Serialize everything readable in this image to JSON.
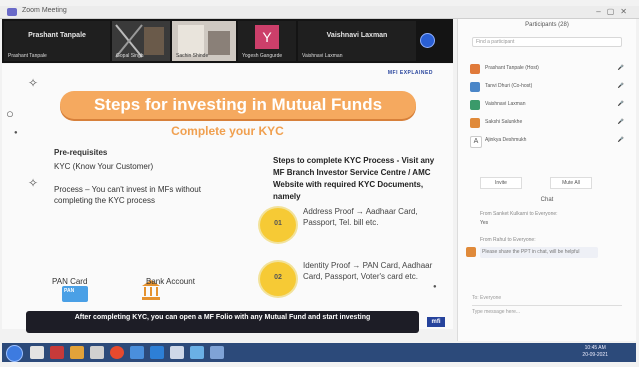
{
  "window": {
    "app_title": "Zoom Meeting"
  },
  "participants_strip": [
    {
      "name": "Prashant Tanpale",
      "caption": "Prashant Tanpale"
    },
    {
      "name": "",
      "caption": "Gopal Singh"
    },
    {
      "name": "",
      "caption": "Sachin Shinde"
    },
    {
      "name": "",
      "caption": "Yogesh Gangurde"
    },
    {
      "name": "Vaishnavi Laxman",
      "caption": "Vaishnavi Laxman"
    }
  ],
  "avatar_letter": "Y",
  "slide": {
    "brand": "MFI EXPLAINED",
    "banner": "Steps for investing in Mutual Funds",
    "subheading": "Complete your KYC",
    "prereq_title": "Pre-requisites",
    "prereq_kyc": "KYC (Know Your Customer)",
    "process_text": "Process – You can't invest in MFs without completing the KYC process",
    "pan_label": "PAN Card",
    "pan_card_text": "PAN",
    "bank_label": "Bank Account",
    "steps_heading": "Steps to complete KYC Process - Visit any MF Branch Investor Service Centre / AMC Website with required KYC Documents, namely",
    "bullets": [
      {
        "num": "01",
        "text": "Address Proof → Aadhaar Card, Passport, Tel. bill etc."
      },
      {
        "num": "02",
        "text": "Identity Proof → PAN Card, Aadhaar Card, Passport, Voter's card etc."
      }
    ],
    "footer": "After completing KYC, you can open a MF Folio with any Mutual Fund and start investing",
    "footer_logo": "mfi"
  },
  "panel": {
    "title": "Participants (28)",
    "search_placeholder": "Find a participant",
    "participants": [
      {
        "name": "Prashant Tanpale (Host)",
        "status": "mic",
        "color": "#e07a3a"
      },
      {
        "name": "Tanvi Dhuri (Co-host)",
        "status": "mic",
        "color": "#4a86c8"
      },
      {
        "name": "Vaishnavi Laxman",
        "status": "mic",
        "color": "#3a9a6a"
      },
      {
        "name": "Sakshi Salunkhe",
        "status": "mic",
        "color": "#e08a3a"
      },
      {
        "name": "Ajinkya Deshmukh",
        "status": "mic",
        "color": "#ffffff"
      }
    ],
    "invite_label": "Invite",
    "mute_label": "Mute All",
    "chat_title": "Chat",
    "chat_messages": [
      "From Sanket Kulkarni to Everyone:",
      "Yes",
      "From Rahul to Everyone:",
      "Please share the PPT in chat, will be helpful"
    ],
    "chat_to": "To: Everyone",
    "chat_placeholder": "Type message here..."
  },
  "taskbar": {
    "time": "10:45 AM",
    "date": "20-09-2021"
  }
}
